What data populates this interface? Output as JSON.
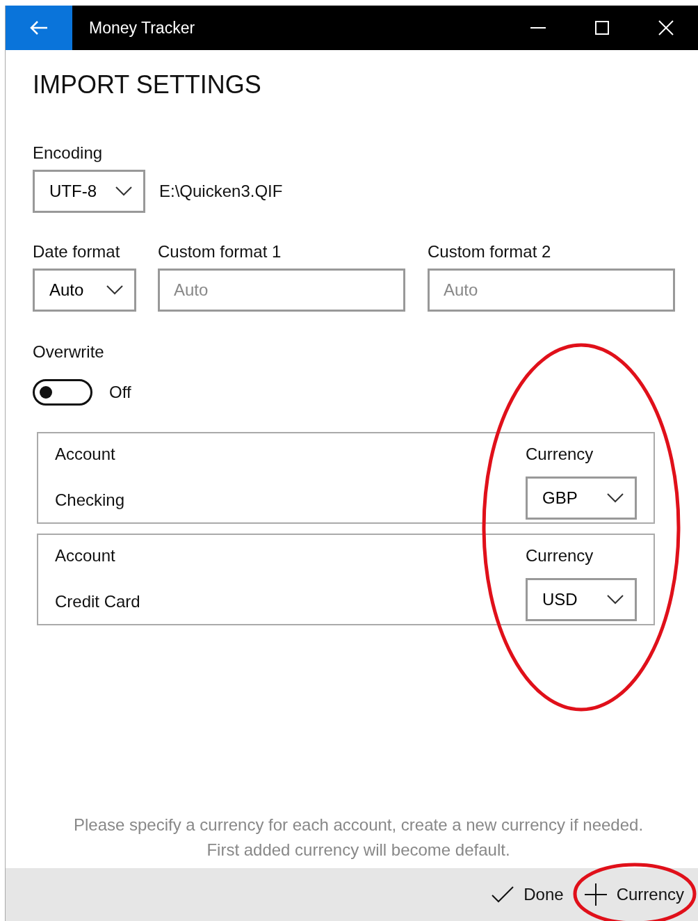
{
  "window": {
    "title": "Money Tracker"
  },
  "page_title": "IMPORT SETTINGS",
  "encoding": {
    "label": "Encoding",
    "value": "UTF-8",
    "file": "E:\\Quicken3.QIF"
  },
  "date_format": {
    "label": "Date format",
    "value": "Auto"
  },
  "custom_formats": [
    {
      "label": "Custom format 1",
      "placeholder": "Auto"
    },
    {
      "label": "Custom format 2",
      "placeholder": "Auto"
    }
  ],
  "overwrite": {
    "label": "Overwrite",
    "on": false,
    "state_text": "Off"
  },
  "accounts": [
    {
      "account_label": "Account",
      "name": "Checking",
      "currency_label": "Currency",
      "currency": "GBP"
    },
    {
      "account_label": "Account",
      "name": "Credit Card",
      "currency_label": "Currency",
      "currency": "USD"
    }
  ],
  "hint": "Please specify a currency for each account, create a new currency if needed. First added currency will become default.",
  "buttons": [
    {
      "label": "Done",
      "kind": "done"
    },
    {
      "label": "Currency",
      "kind": "add"
    }
  ],
  "highlights": [
    {
      "kind": "ellipse",
      "color": "#e0101a"
    },
    {
      "kind": "ellipse",
      "color": "#e0101a"
    }
  ]
}
